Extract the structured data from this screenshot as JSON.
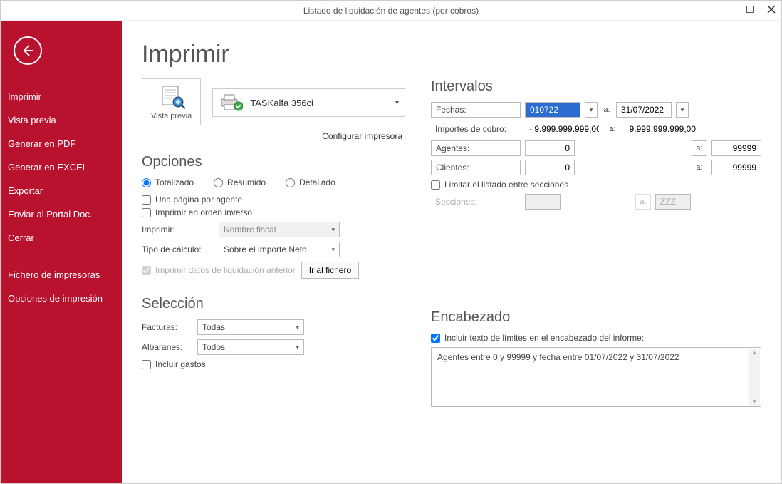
{
  "window": {
    "title": "Listado de liquidación de agentes (por cobros)"
  },
  "sidebar": {
    "items": [
      "Imprimir",
      "Vista previa",
      "Generar en PDF",
      "Generar en EXCEL",
      "Exportar",
      "Enviar al Portal Doc.",
      "Cerrar"
    ],
    "items2": [
      "Fichero de impresoras",
      "Opciones de impresión"
    ]
  },
  "page": {
    "heading": "Imprimir",
    "preview_label": "Vista previa",
    "printer_name": "TASKalfa 356ci",
    "config_link": "Configurar impresora"
  },
  "options": {
    "heading": "Opciones",
    "mode": {
      "totalizado": "Totalizado",
      "resumido": "Resumido",
      "detallado": "Detallado",
      "selected": "Totalizado"
    },
    "one_page_per_agent": {
      "label": "Una página por agente",
      "checked": false
    },
    "reverse": {
      "label": "Imprimir en orden inverso",
      "checked": false
    },
    "print_label": "Imprimir:",
    "print_value": "Nombre fiscal",
    "calc_label": "Tipo de cálculo:",
    "calc_value": "Sobre el importe Neto",
    "prev_data": {
      "label": "Imprimir datos de liquidación anterior",
      "checked": true
    },
    "goto_file": "Ir al fichero"
  },
  "selection": {
    "heading": "Selección",
    "facturas_label": "Facturas:",
    "facturas_value": "Todas",
    "albaranes_label": "Albaranes:",
    "albaranes_value": "Todos",
    "incluir_gastos": {
      "label": "Incluir gastos",
      "checked": false
    }
  },
  "intervals": {
    "heading": "Intervalos",
    "fechas_label": "Fechas:",
    "fechas_from": "010722",
    "fechas_to": "31/07/2022",
    "importes_label": "Importes de cobro:",
    "importes_from": "- 9.999.999.999,00",
    "importes_to": "9.999.999.999,00",
    "agentes_label": "Agentes:",
    "agentes_from": "0",
    "agentes_to": "99999",
    "clientes_label": "Clientes:",
    "clientes_from": "0",
    "clientes_to": "99999",
    "limit_sections": {
      "label": "Limitar el listado entre secciones",
      "checked": false
    },
    "secciones_label": "Secciones:",
    "secciones_from": "",
    "secciones_to": "ZZZ",
    "a": "a:"
  },
  "header_section": {
    "heading": "Encabezado",
    "include_limits": {
      "label": "Incluir texto de límites en el encabezado del informe:",
      "checked": true
    },
    "text": "Agentes entre 0 y 99999 y fecha entre 01/07/2022 y 31/07/2022"
  }
}
